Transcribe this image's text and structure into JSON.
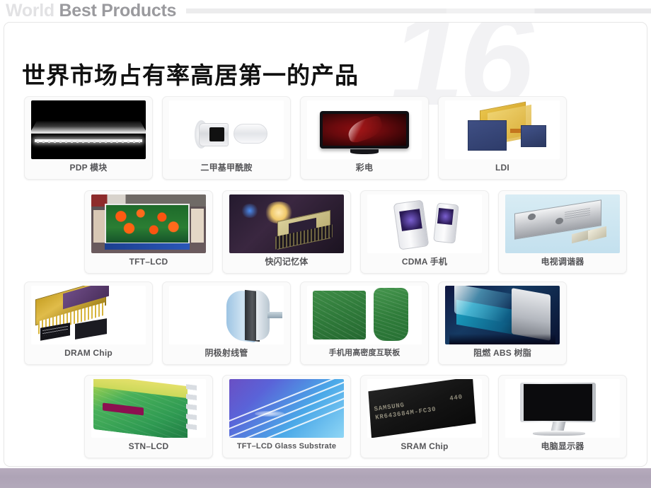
{
  "header": {
    "title_light": "World",
    "title_dark": "Best Products"
  },
  "slide": {
    "watermark": "16",
    "heading": "世界市场占有率高居第一的产品"
  },
  "products": {
    "row1": [
      {
        "label": "PDP 模块",
        "art": "pdp"
      },
      {
        "label": "二甲基甲酰胺",
        "art": "dmf"
      },
      {
        "label": "彩电",
        "art": "tv"
      },
      {
        "label": "LDI",
        "art": "ldi"
      }
    ],
    "row2": [
      {
        "label": "TFT–LCD",
        "art": "tft"
      },
      {
        "label": "快闪记忆体",
        "art": "flash"
      },
      {
        "label": "CDMA 手机",
        "art": "cdma"
      },
      {
        "label": "电视调谐器",
        "art": "tuner"
      }
    ],
    "row3": [
      {
        "label": "DRAM Chip",
        "art": "dram"
      },
      {
        "label": "阴极射线管",
        "art": "crt"
      },
      {
        "label": "手机用高密度互联板",
        "art": "hdi"
      },
      {
        "label": "阻燃 ABS 树脂",
        "art": "abs"
      }
    ],
    "row4": [
      {
        "label": "STN–LCD",
        "art": "stn"
      },
      {
        "label": "TFT–LCD Glass Substrate",
        "art": "glass"
      },
      {
        "label": "SRAM Chip",
        "art": "sram"
      },
      {
        "label": "电脑显示器",
        "art": "mon"
      }
    ]
  },
  "sram_chip_markings": {
    "line1_brand": "SAMSUNG",
    "line1_code": "440",
    "line2": "KR643684M-FC30"
  },
  "colors": {
    "footer_bar": "#b0a6b8",
    "heading_text": "#111111",
    "card_label_text": "#555558",
    "header_light": "#e2e2e4",
    "header_dark": "#9a9a9e"
  }
}
